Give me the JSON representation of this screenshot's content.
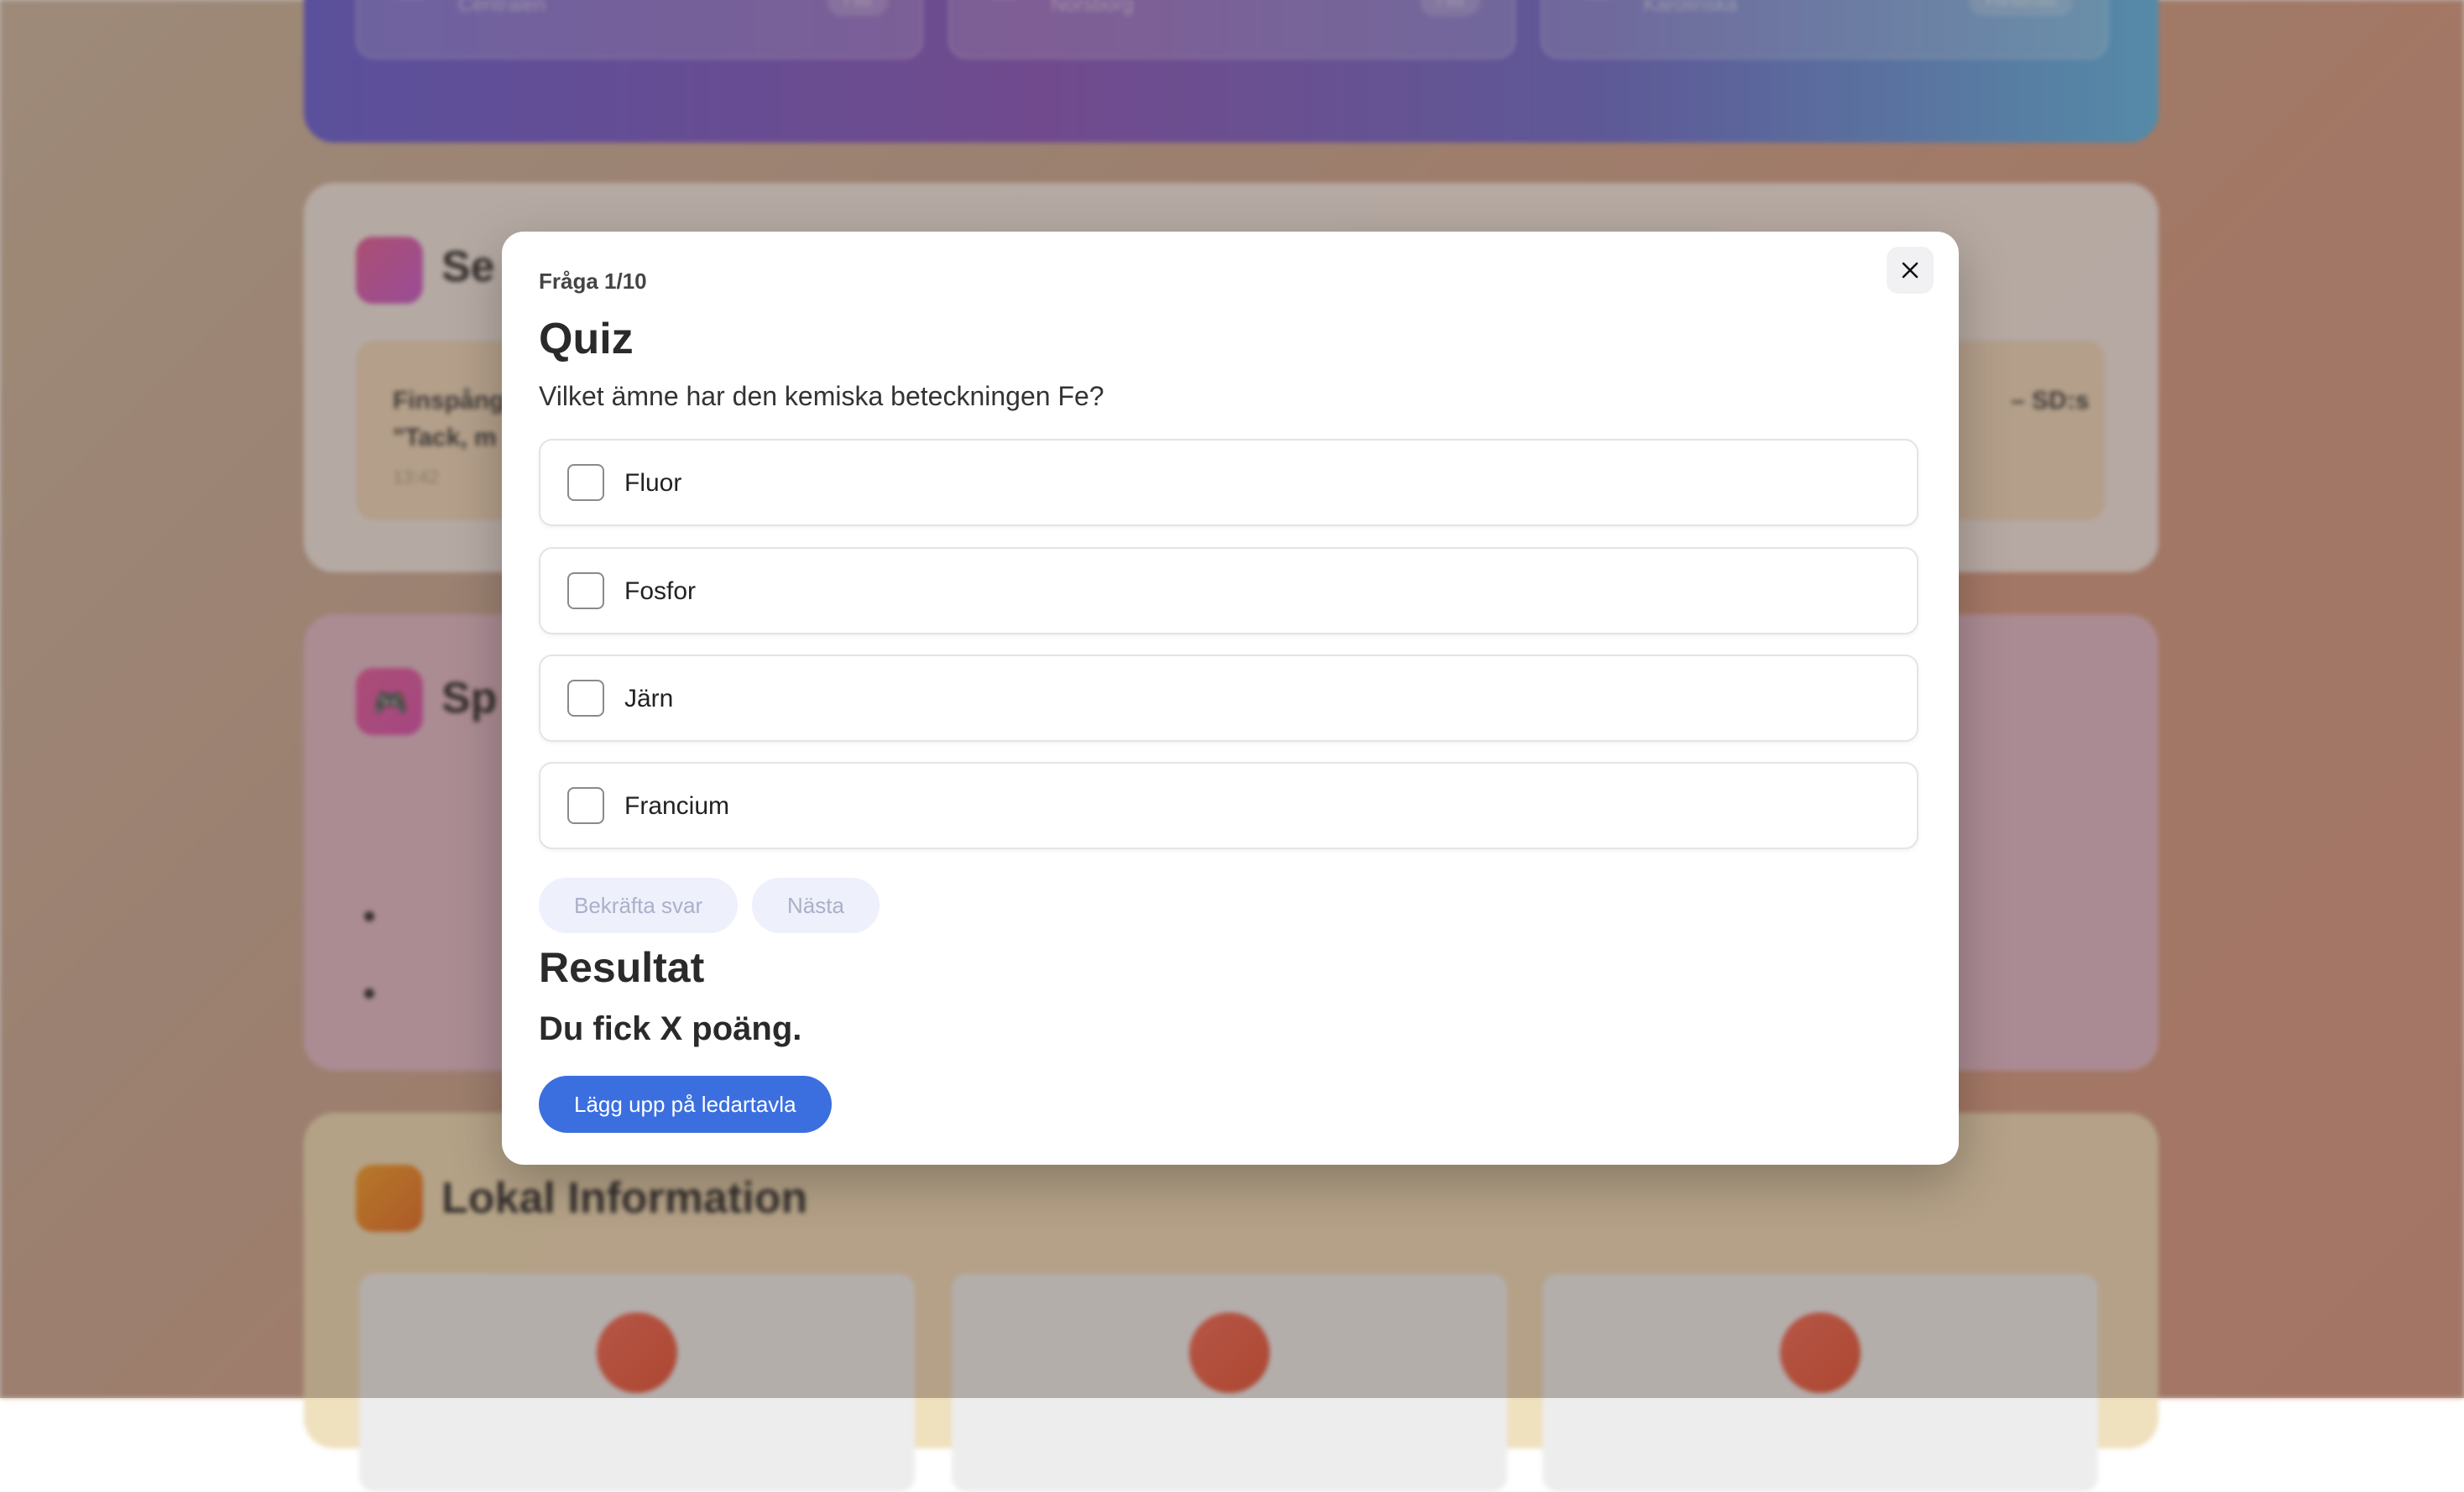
{
  "background": {
    "transit_cards": [
      {
        "stop": "Centralen",
        "badge": "I tid"
      },
      {
        "stop": "Norsborg",
        "badge": "I tid"
      },
      {
        "stop": "Karolinska",
        "badge": "Försenad"
      }
    ],
    "news_section": {
      "title": "Se",
      "cards": [
        {
          "text_line1": "Finspång",
          "text_line2": "\"Tack, m",
          "time": "13:42"
        },
        {
          "text_line1": "– SD:s",
          "text_line2": "",
          "time": ""
        }
      ]
    },
    "games_section": {
      "title": "Sp",
      "icon": "gamepad-icon",
      "icon_glyph": "🎮"
    },
    "info_section": {
      "title": "Lokal Information"
    }
  },
  "modal": {
    "counter": "Fråga 1/10",
    "title": "Quiz",
    "question": "Vilket ämne har den kemiska beteckningen Fe?",
    "options": [
      {
        "label": "Fluor",
        "checked": false
      },
      {
        "label": "Fosfor",
        "checked": false
      },
      {
        "label": "Järn",
        "checked": false
      },
      {
        "label": "Francium",
        "checked": false
      }
    ],
    "confirm_label": "Bekräfta svar",
    "next_label": "Nästa",
    "result_title": "Resultat",
    "result_text": "Du fick X poäng.",
    "leaderboard_label": "Lägg upp på ledartavla",
    "close_icon": "close-icon"
  },
  "colors": {
    "primary": "#3b6fe0",
    "disabled_button_bg": "#eef0fb",
    "disabled_button_text": "#aab0c8"
  }
}
